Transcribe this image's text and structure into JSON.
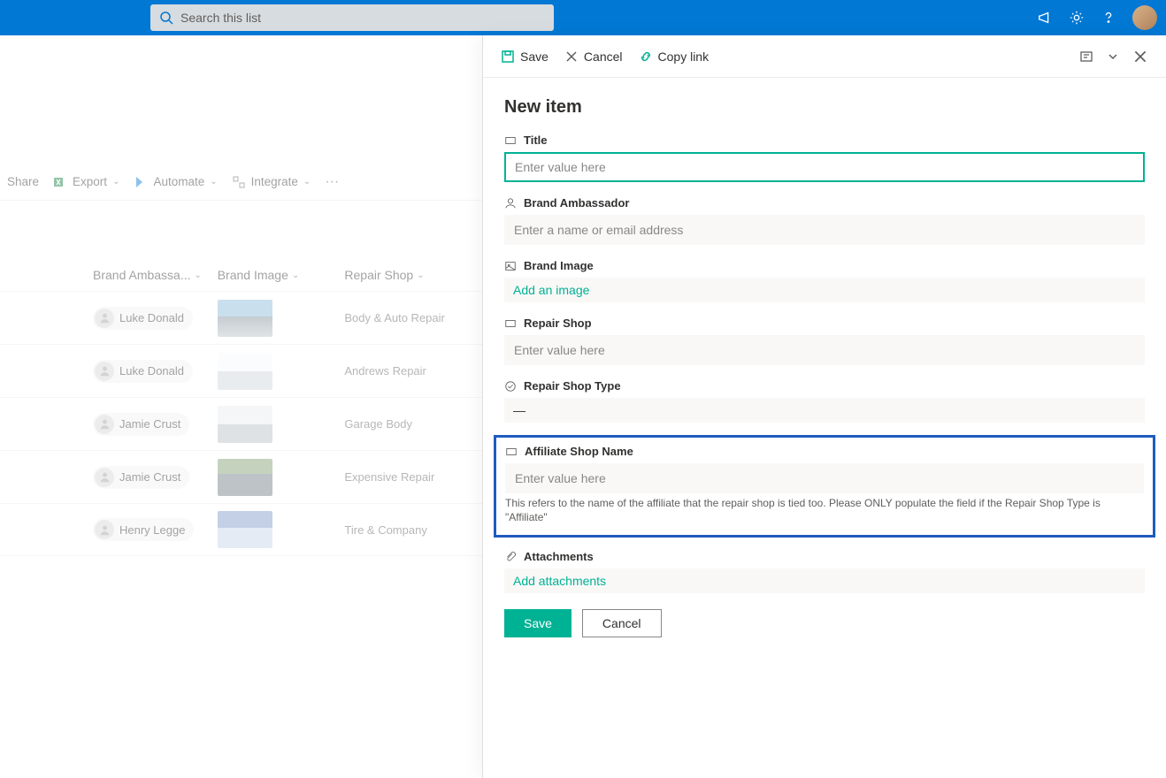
{
  "header": {
    "search_placeholder": "Search this list"
  },
  "commands": {
    "share": "Share",
    "export": "Export",
    "automate": "Automate",
    "integrate": "Integrate"
  },
  "columns": {
    "ambassador": "Brand Ambassa...",
    "image": "Brand Image",
    "shop": "Repair Shop"
  },
  "rows": [
    {
      "person": "Luke Donald",
      "shop": "Body & Auto Repair",
      "thumb": "sky"
    },
    {
      "person": "Luke Donald",
      "shop": "Andrews Repair",
      "thumb": "silver"
    },
    {
      "person": "Jamie Crust",
      "shop": "Garage Body",
      "thumb": "gray"
    },
    {
      "person": "Jamie Crust",
      "shop": "Expensive Repair",
      "thumb": "lot"
    },
    {
      "person": "Henry Legge",
      "shop": "Tire & Company",
      "thumb": "blue"
    }
  ],
  "panel": {
    "save": "Save",
    "cancel": "Cancel",
    "copylink": "Copy link",
    "title": "New item",
    "fields": {
      "title_label": "Title",
      "title_ph": "Enter value here",
      "ambassador_label": "Brand Ambassador",
      "ambassador_ph": "Enter a name or email address",
      "image_label": "Brand Image",
      "image_action": "Add an image",
      "shop_label": "Repair Shop",
      "shop_ph": "Enter value here",
      "type_label": "Repair Shop Type",
      "type_value": "—",
      "affiliate_label": "Affiliate Shop Name",
      "affiliate_ph": "Enter value here",
      "affiliate_hint": "This refers to the name of the affiliate that the repair shop is tied too. Please ONLY populate the field if the Repair Shop Type is \"Affiliate\"",
      "attach_label": "Attachments",
      "attach_action": "Add attachments"
    },
    "buttons": {
      "save": "Save",
      "cancel": "Cancel"
    }
  }
}
